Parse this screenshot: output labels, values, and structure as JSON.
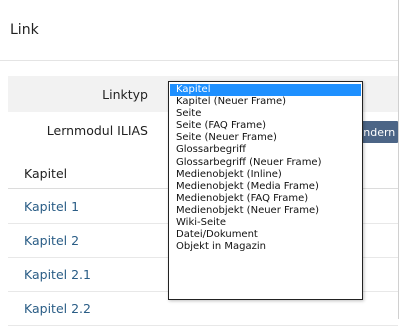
{
  "dialog": {
    "title": "Link"
  },
  "form": {
    "link_type_label": "Linktyp",
    "learning_module_label": "Lernmodul ILIAS",
    "change_button_label": "Ändern"
  },
  "list": {
    "header": "Kapitel",
    "items": [
      "Kapitel 1",
      "Kapitel 2",
      "Kapitel 2.1",
      "Kapitel 2.2"
    ]
  },
  "dropdown": {
    "selected": "Kapitel",
    "options": [
      "Kapitel",
      "Kapitel (Neuer Frame)",
      "Seite",
      "Seite (FAQ Frame)",
      "Seite (Neuer Frame)",
      "Glossarbegriff",
      "Glossarbegriff (Neuer Frame)",
      "Medienobjekt (Inline)",
      "Medienobjekt (Media Frame)",
      "Medienobjekt (FAQ Frame)",
      "Medienobjekt (Neuer Frame)",
      "Wiki-Seite",
      "Datei/Dokument",
      "Objekt in Magazin"
    ]
  },
  "colors": {
    "selected_option": "#1e90ff",
    "link_text": "#2a5d86",
    "button_bg": "#4c6586"
  }
}
